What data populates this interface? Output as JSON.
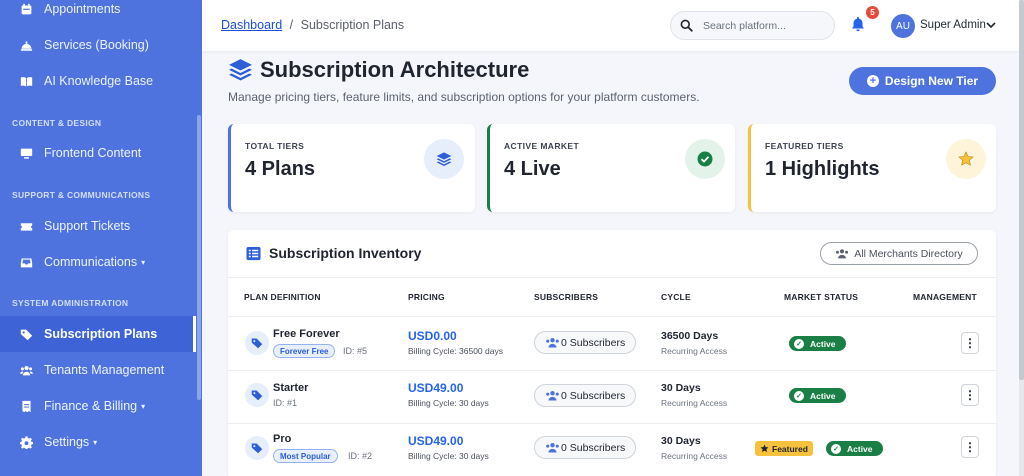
{
  "sidebar": {
    "items": [
      {
        "label": "Appointments",
        "icon": "calendar-icon"
      },
      {
        "label": "Services (Booking)",
        "icon": "bell-concierge-icon"
      },
      {
        "label": "AI Knowledge Base",
        "icon": "book-icon"
      },
      {
        "label": "Frontend Content",
        "icon": "monitor-icon"
      },
      {
        "label": "Support Tickets",
        "icon": "ticket-icon"
      },
      {
        "label": "Communications",
        "icon": "inbox-icon"
      },
      {
        "label": "Subscription Plans",
        "icon": "tag-icon"
      },
      {
        "label": "Tenants Management",
        "icon": "users-icon"
      },
      {
        "label": "Finance & Billing",
        "icon": "receipt-icon"
      },
      {
        "label": "Settings",
        "icon": "gear-icon"
      }
    ],
    "sections": {
      "content_design": "CONTENT & DESIGN",
      "support": "SUPPORT & COMMUNICATIONS",
      "system": "SYSTEM ADMINISTRATION"
    }
  },
  "topbar": {
    "breadcrumb_link": "Dashboard",
    "breadcrumb_sep": "/",
    "breadcrumb_current": "Subscription Plans",
    "search_placeholder": "Search platform...",
    "notification_count": "5",
    "avatar_initials": "AU",
    "user_name": "Super Admin"
  },
  "page": {
    "title": "Subscription Architecture",
    "subtitle": "Manage pricing tiers, feature limits, and subscription options for your platform customers.",
    "design_button": "Design New Tier"
  },
  "stats": [
    {
      "label": "TOTAL TIERS",
      "value": "4 Plans",
      "accent": "#4e73df"
    },
    {
      "label": "ACTIVE MARKET",
      "value": "4 Live",
      "accent": "#1a7f45"
    },
    {
      "label": "FEATURED TIERS",
      "value": "1 Highlights",
      "accent": "#f6c23e"
    }
  ],
  "inventory": {
    "title": "Subscription Inventory",
    "merchants_button": "All Merchants Directory",
    "columns": [
      "PLAN DEFINITION",
      "PRICING",
      "SUBSCRIBERS",
      "CYCLE",
      "MARKET STATUS",
      "MANAGEMENT"
    ],
    "rows": [
      {
        "name": "Free Forever",
        "badge": "Forever Free",
        "id": "ID: #5",
        "price": "USD0.00",
        "billing": "Billing Cycle: 36500 days",
        "subscribers": "0 Subscribers",
        "cycle": "36500 Days",
        "cycle_sub": "Recurring Access",
        "featured": "",
        "status": "Active"
      },
      {
        "name": "Starter",
        "badge": "",
        "id": "ID: #1",
        "price": "USD49.00",
        "billing": "Billing Cycle: 30 days",
        "subscribers": "0 Subscribers",
        "cycle": "30 Days",
        "cycle_sub": "Recurring Access",
        "featured": "",
        "status": "Active"
      },
      {
        "name": "Pro",
        "badge": "Most Popular",
        "id": "ID: #2",
        "price": "USD49.00",
        "billing": "Billing Cycle: 30 days",
        "subscribers": "0 Subscribers",
        "cycle": "30 Days",
        "cycle_sub": "Recurring Access",
        "featured": "Featured",
        "status": "Active"
      }
    ]
  },
  "colors": {
    "sidebar": "#4e73df",
    "primary": "#2563eb",
    "success": "#1a7f45",
    "warning": "#f6c23e"
  }
}
